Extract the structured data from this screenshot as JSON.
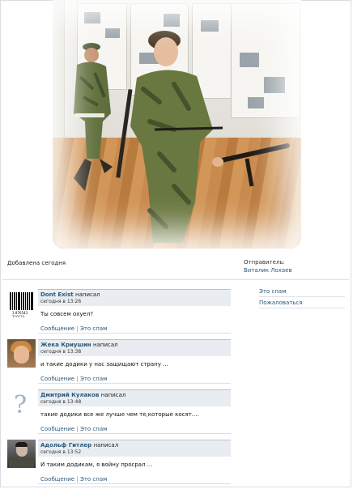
{
  "photo_caption": {
    "added": "Добавлена сегодня",
    "sender_label": "Отправитель:",
    "sender_name": "Виталик Лохаев"
  },
  "side_actions": [
    {
      "label": "Это спам"
    },
    {
      "label": "Пожаловаться"
    }
  ],
  "comments": [
    {
      "author": "Dont Exist",
      "wrote": "написал",
      "date": "сегодня в 13:26",
      "text": "Ты совсем охуел?",
      "reply": "Сообщение",
      "spam": "Это спам",
      "avatar": "barcode-avatar",
      "avatar_caption": "3 876543 210123"
    },
    {
      "author": "Жека Криушин",
      "wrote": "написал",
      "date": "сегодня в 13:38",
      "text": "и такие додики у нас защищают страну ...",
      "reply": "Сообщение",
      "spam": "Это спам",
      "avatar": "photo-avatar"
    },
    {
      "author": "Дмитрий Кулаков",
      "wrote": "написал",
      "date": "сегодня в 13:48",
      "text": "такие додики все же лучше чем те,которые косят....",
      "reply": "Сообщение",
      "spam": "Это спам",
      "avatar": "question-mark-avatar",
      "avatar_glyph": "?"
    },
    {
      "author": "Адольф Гитлер",
      "wrote": "написал",
      "date": "сегодня в 13:52",
      "text": "И таким додикам, я войну просрал ...",
      "reply": "Сообщение",
      "spam": "Это спам",
      "avatar": "portrait-avatar"
    }
  ],
  "colors": {
    "link": "#2b587a",
    "header_bg": "#e9edf1",
    "header_border": "#b6c3cf"
  }
}
